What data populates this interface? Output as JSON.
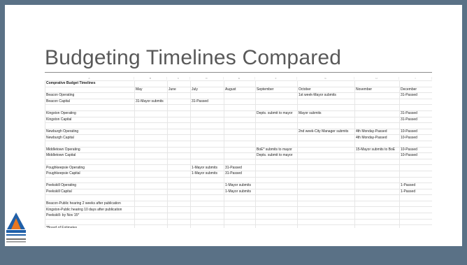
{
  "slide": {
    "title": "Budgeting Timelines Compared"
  },
  "sheet": {
    "column_letters": [
      "A",
      "B",
      "C",
      "D",
      "E",
      "F",
      "G",
      "H",
      "I"
    ],
    "sheet_title": "Comprative Budget Timelines",
    "columns": [
      "",
      "May",
      "June",
      "July",
      "August",
      "September",
      "October",
      "November",
      "December"
    ],
    "rows": [
      [
        "Beacon Operating",
        "",
        "",
        "",
        "",
        "",
        "1st week-Mayor submits",
        "",
        "31-Passed"
      ],
      [
        "Beacon Capital",
        "31-Mayor submits",
        "",
        "31-Passed",
        "",
        "",
        "",
        "",
        ""
      ],
      [
        "",
        "",
        "",
        "",
        "",
        "",
        "",
        "",
        ""
      ],
      [
        "Kingston Operating",
        "",
        "",
        "",
        "",
        "Depts. submit to mayor",
        "Mayor submits",
        "",
        "31-Passed"
      ],
      [
        "Kingston Capital",
        "",
        "",
        "",
        "",
        "",
        "",
        "",
        "31-Passed"
      ],
      [
        "",
        "",
        "",
        "",
        "",
        "",
        "",
        "",
        ""
      ],
      [
        "Newburgh Operating",
        "",
        "",
        "",
        "",
        "",
        "2nd week-City Manager submits",
        "4th Monday-Passed",
        "10-Passed"
      ],
      [
        "Newburgh Capital",
        "",
        "",
        "",
        "",
        "",
        "",
        "4th Monday-Passed",
        "10-Passed"
      ],
      [
        "",
        "",
        "",
        "",
        "",
        "",
        "",
        "",
        ""
      ],
      [
        "Middletown Operating",
        "",
        "",
        "",
        "",
        "BoE* submits to mayor",
        "",
        "15-Mayor submits to BoE",
        "10-Passed"
      ],
      [
        "Middletown Capital",
        "",
        "",
        "",
        "",
        "Depts. submit to mayor",
        "",
        "",
        "10-Passed"
      ],
      [
        "",
        "",
        "",
        "",
        "",
        "",
        "",
        "",
        ""
      ],
      [
        "Poughkeepsie Operating",
        "",
        "",
        "1-Mayor submits",
        "31-Passed",
        "",
        "",
        "",
        ""
      ],
      [
        "Poughkeepsie Capital",
        "",
        "",
        "1-Mayor submits",
        "31-Passed",
        "",
        "",
        "",
        ""
      ],
      [
        "",
        "",
        "",
        "",
        "",
        "",
        "",
        "",
        ""
      ],
      [
        "Peekskill Operating",
        "",
        "",
        "",
        "1-Mayor submits",
        "",
        "",
        "",
        "1-Passed"
      ],
      [
        "Peekskill Capital",
        "",
        "",
        "",
        "1-Mayor submits",
        "",
        "",
        "",
        "1-Passed"
      ],
      [
        "",
        "",
        "",
        "",
        "",
        "",
        "",
        "",
        ""
      ],
      [
        "Beacon-Public hearing 2 weeks after publication",
        "",
        "",
        "",
        "",
        "",
        "",
        "",
        ""
      ],
      [
        "Kingston-Public hearing 10 days after publication",
        "",
        "",
        "",
        "",
        "",
        "",
        "",
        ""
      ],
      [
        "Peekskill- by Nov 15*",
        "",
        "",
        "",
        "",
        "",
        "",
        "",
        ""
      ],
      [
        "",
        "",
        "",
        "",
        "",
        "",
        "",
        "",
        ""
      ],
      [
        "*Board of Estimates",
        "",
        "",
        "",
        "",
        "",
        "",
        "",
        ""
      ],
      [
        "",
        "",
        "",
        "",
        "",
        "",
        "",
        "",
        ""
      ]
    ]
  },
  "colors": {
    "band": "#5a7186",
    "logo_blue": "#1f5fa8",
    "logo_orange": "#e87722"
  },
  "logo": {
    "icon": "pattern-logo-icon",
    "caption": "PATTERN"
  }
}
